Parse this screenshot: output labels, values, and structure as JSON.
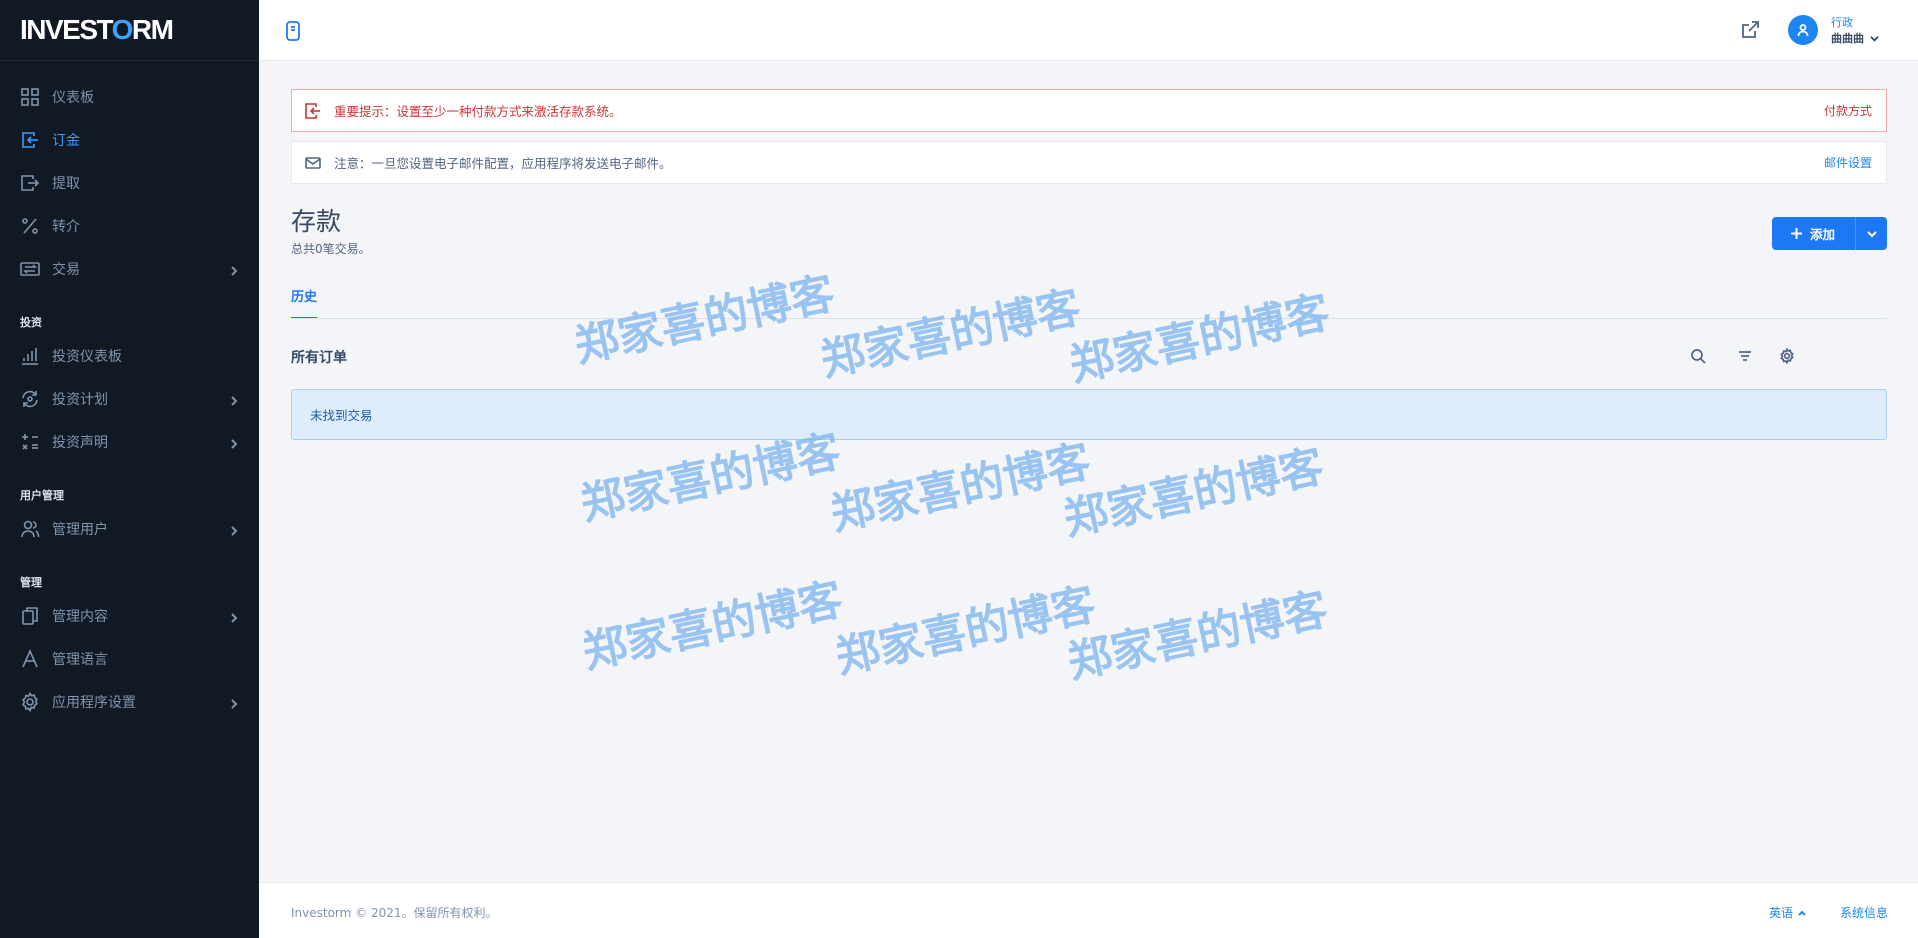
{
  "brand": {
    "logo_left": "INVEST",
    "logo_o": "O",
    "logo_right": "RM"
  },
  "sidebar": {
    "items": [
      {
        "label": "仪表板",
        "icon": "grid-icon"
      },
      {
        "label": "订金",
        "icon": "deposit-icon",
        "active": true
      },
      {
        "label": "提取",
        "icon": "withdraw-icon"
      },
      {
        "label": "转介",
        "icon": "percent-icon"
      },
      {
        "label": "交易",
        "icon": "exchange-icon"
      }
    ],
    "section_invest": "投资",
    "invest_items": [
      {
        "label": "投资仪表板",
        "icon": "bar-chart-icon"
      },
      {
        "label": "投资计划",
        "icon": "refresh-coin-icon"
      },
      {
        "label": "投资声明",
        "icon": "calc-icon"
      }
    ],
    "section_users": "用户管理",
    "user_items": [
      {
        "label": "管理用户",
        "icon": "users-icon"
      }
    ],
    "section_manage": "管理",
    "manage_items": [
      {
        "label": "管理内容",
        "icon": "copy-icon"
      },
      {
        "label": "管理语言",
        "icon": "font-icon"
      },
      {
        "label": "应用程序设置",
        "icon": "gear-icon"
      }
    ]
  },
  "header": {
    "user_role": "行政",
    "user_name": "曲曲曲"
  },
  "alerts": {
    "danger_text": "重要提示：设置至少一种付款方式来激活存款系统。",
    "danger_link": "付款方式",
    "info_text": "注意：一旦您设置电子邮件配置，应用程序将发送电子邮件。",
    "info_link": "邮件设置"
  },
  "page": {
    "title": "存款",
    "subtitle": "总共0笔交易。",
    "add_label": "添加",
    "tab": "历史",
    "card_title": "所有订单",
    "empty_text": "未找到交易"
  },
  "watermark": "郑家喜的博客",
  "footer": {
    "copyright": "Investorm © 2021。保留所有权利。",
    "language": "英语",
    "system_info": "系统信息"
  },
  "colors": {
    "primary": "#1d78f5",
    "sidebar_bg": "#101924",
    "danger": "#c93636"
  }
}
